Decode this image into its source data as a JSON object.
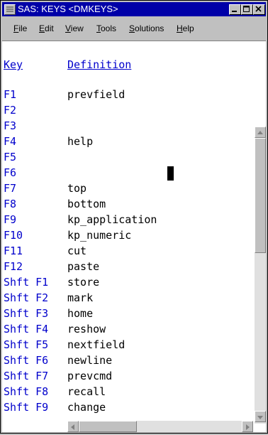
{
  "window": {
    "title": "SAS: KEYS <DMKEYS>"
  },
  "menu": {
    "items": [
      {
        "label": "File",
        "ul": "F",
        "rest": "ile"
      },
      {
        "label": "Edit",
        "ul": "E",
        "rest": "dit"
      },
      {
        "label": "View",
        "ul": "V",
        "rest": "iew"
      },
      {
        "label": "Tools",
        "ul": "T",
        "rest": "ools"
      },
      {
        "label": "Solutions",
        "ul": "S",
        "rest": "olutions"
      },
      {
        "label": "Help",
        "ul": "H",
        "rest": "elp"
      }
    ]
  },
  "table": {
    "header_key": "Key",
    "header_definition": "Definition",
    "rows": [
      {
        "key": "F1",
        "def": "prevfield"
      },
      {
        "key": "F2",
        "def": ""
      },
      {
        "key": "F3",
        "def": ""
      },
      {
        "key": "F4",
        "def": "help"
      },
      {
        "key": "F5",
        "def": ""
      },
      {
        "key": "F6",
        "def": ""
      },
      {
        "key": "F7",
        "def": "top"
      },
      {
        "key": "F8",
        "def": "bottom"
      },
      {
        "key": "F9",
        "def": "kp_application"
      },
      {
        "key": "F10",
        "def": "kp_numeric"
      },
      {
        "key": "F11",
        "def": "cut"
      },
      {
        "key": "F12",
        "def": "paste"
      },
      {
        "key": "Shft F1",
        "def": "store"
      },
      {
        "key": "Shft F2",
        "def": "mark"
      },
      {
        "key": "Shft F3",
        "def": "home"
      },
      {
        "key": "Shft F4",
        "def": "reshow"
      },
      {
        "key": "Shft F5",
        "def": "nextfield"
      },
      {
        "key": "Shft F6",
        "def": "newline"
      },
      {
        "key": "Shft F7",
        "def": "prevcmd"
      },
      {
        "key": "Shft F8",
        "def": "recall"
      },
      {
        "key": "Shft F9",
        "def": "change"
      }
    ]
  }
}
